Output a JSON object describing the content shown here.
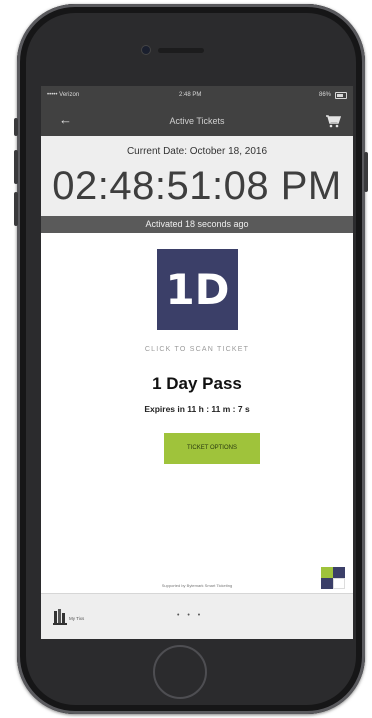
{
  "status_bar": {
    "carrier": "••••• Verizon",
    "time": "2:48 PM",
    "battery": "86%"
  },
  "nav": {
    "title": "Active Tickets",
    "back_icon": "arrow-left-icon",
    "cart_icon": "cart-icon"
  },
  "current": {
    "date_label": "Current Date: October 18, 2016",
    "clock": "02:48:51:08 PM"
  },
  "activated": "Activated 18 seconds ago",
  "ticket": {
    "logo_text": "1D",
    "scan_label": "CLICK TO SCAN TICKET",
    "pass_name": "1 Day Pass",
    "expires": "Expires in 11 h : 11 m : 7 s",
    "options_button": "TICKET OPTIONS"
  },
  "footer": {
    "text": "Supported by Bytemark Smart Ticketing"
  },
  "bottom_bar": {
    "label": "My Tixs",
    "dots": "• • •"
  },
  "colors": {
    "header_dark": "#414141",
    "ticket_navy": "#3b3f68",
    "accent_green": "#9fc33b"
  }
}
